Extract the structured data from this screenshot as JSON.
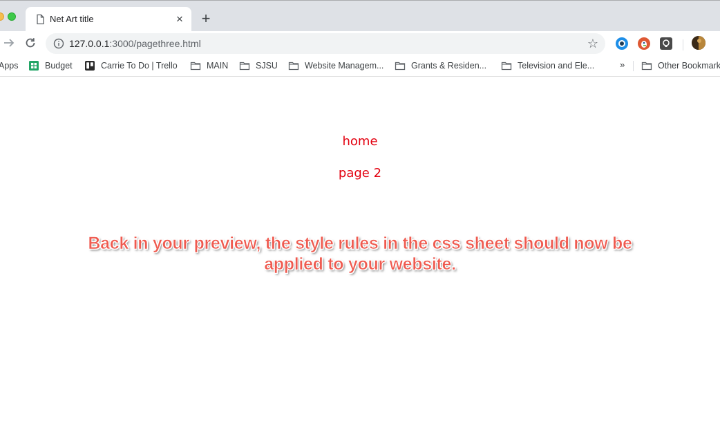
{
  "browser": {
    "tab": {
      "title": "Net Art title",
      "close_glyph": "×"
    },
    "new_tab_glyph": "+",
    "address": {
      "host": "127.0.0.1",
      "rest": ":3000/pagethree.html"
    },
    "bookmarks": [
      {
        "label": "Apps",
        "icon": "apps-grid-icon"
      },
      {
        "label": "Budget",
        "icon": "sheets-icon"
      },
      {
        "label": "Carrie To Do | Trello",
        "icon": "trello-icon"
      },
      {
        "label": "MAIN",
        "icon": "folder-icon"
      },
      {
        "label": "SJSU",
        "icon": "folder-icon"
      },
      {
        "label": "Website Managem...",
        "icon": "folder-icon"
      },
      {
        "label": "Grants & Residen...",
        "icon": "folder-icon"
      },
      {
        "label": "Television and Ele...",
        "icon": "folder-icon"
      }
    ],
    "bookmarks_overflow": "»",
    "other_bookmarks": "Other Bookmarks"
  },
  "page": {
    "links": [
      "home",
      "page 2"
    ],
    "caption": "Back in your preview, the style rules in the css sheet should now be applied to your website."
  },
  "colors": {
    "link": "#e3000f",
    "caption": "#ef5a4f"
  }
}
